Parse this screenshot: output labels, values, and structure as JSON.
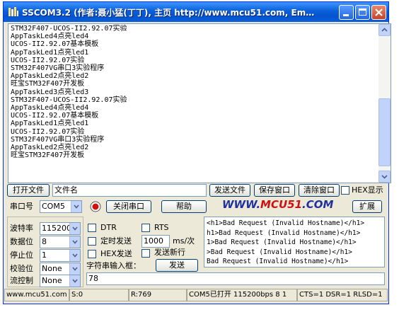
{
  "window": {
    "title": "SSCOM3.2 (作者:聂小猛(丁丁), 主页 http://www.mcu51.com, Em…"
  },
  "output": {
    "text": "STM32F407-UCOS-II2.92.07实验\nAppTaskLed4点亮led4\nUCOS-II2.92.07基本模板\nAppTaskLed1点亮led1\nUCOS-II2.92.07实验\nSTM32F407VG串口3实验程序\nAppTaskLed2点亮led2\n旺宝STM32F407开发板\nAppTaskLed3点亮led3\nSTM32F407-UCOS-II2.92.07实验\nAppTaskLed4点亮led4\nUCOS-II2.92.07基本模板\nAppTaskLed1点亮led1\nUCOS-II2.92.07实验\nSTM32F407VG串口3实验程序\nAppTaskLed2点亮led2\n旺宝STM32F407开发板"
  },
  "toolbar1": {
    "open_file": "打开文件",
    "filename_value": "文件名",
    "send_file": "发送文件",
    "save_window": "保存窗口",
    "clear_window": "清除窗口",
    "hex_display": "HEX显示"
  },
  "toolbar2": {
    "port_label": "串口号",
    "port_value": "COM5",
    "close_port": "关闭串口",
    "help": "帮助",
    "url_prefix": "WWW.",
    "url_brand": "MCU51",
    "url_suffix": ".COM",
    "expand": "扩展"
  },
  "settings": {
    "baud_label": "波特率",
    "baud_value": "115200",
    "databits_label": "数据位",
    "databits_value": "8",
    "stopbits_label": "停止位",
    "stopbits_value": "1",
    "parity_label": "校验位",
    "parity_value": "None",
    "flow_label": "流控制",
    "flow_value": "None"
  },
  "options": {
    "dtr": "DTR",
    "rts": "RTS",
    "timed_send": "定时发送",
    "interval_value": "1000",
    "interval_unit": "ms/次",
    "hex_send": "HEX发送",
    "send_newline": "发送新行",
    "string_input_label": "字符串输入框：",
    "send": "发送"
  },
  "response": {
    "text": "<h1>Bad Request (Invalid Hostname)</h1>\nh1>Bad Request (Invalid Hostname)</h1>\n1>Bad Request (Invalid Hostname)</h1>\n>Bad Request (Invalid Hostname)</h1>\nBad Request (Invalid Hostname)</h1>"
  },
  "input": {
    "value": "78"
  },
  "status": {
    "site": "www.mcu51.com",
    "s": "S:0",
    "r": "R:769",
    "port_state": "COM5已打开  115200bps  8 1",
    "lines": "CTS=1 DSR=1 RLSD=1"
  },
  "colors": {
    "titlebar": "#0a5fd8",
    "window_bg": "#ece9d8",
    "url_blue": "#2030a0",
    "url_red": "#d01010"
  }
}
